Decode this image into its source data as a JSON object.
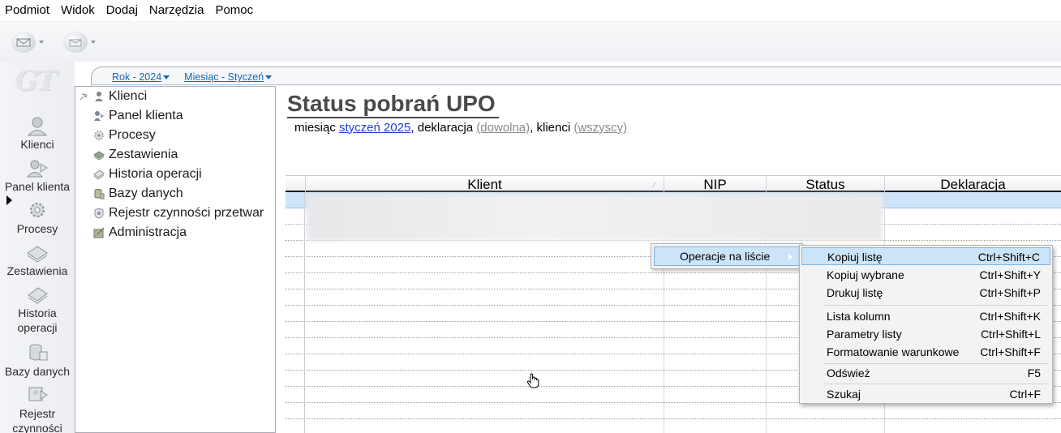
{
  "menubar": {
    "items": [
      "Podmiot",
      "Widok",
      "Dodaj",
      "Narzędzia",
      "Pomoc"
    ]
  },
  "toolbar": {
    "buttons": [
      {
        "icon": "mail-send-icon"
      },
      {
        "icon": "mail-receive-icon"
      }
    ]
  },
  "leftnav": {
    "logo": "GT",
    "items": [
      {
        "label": "Klienci",
        "icon": "person-icon"
      },
      {
        "label": "Panel klienta",
        "icon": "person-panel-icon"
      },
      {
        "label": "Procesy",
        "icon": "gears-icon"
      },
      {
        "label": "Zestawienia",
        "icon": "reports-icon"
      },
      {
        "label": "Historia operacji",
        "icon": "history-icon"
      },
      {
        "label": "Bazy danych",
        "icon": "database-icon"
      },
      {
        "label": "Rejestr czynności",
        "icon": "register-icon"
      }
    ]
  },
  "period": {
    "year": "Rok - 2024",
    "month": "Miesiąc - Styczeń"
  },
  "tree": {
    "items": [
      {
        "label": "Klienci",
        "icon": "person-icon"
      },
      {
        "label": "Panel klienta",
        "icon": "person-panel-icon"
      },
      {
        "label": "Procesy",
        "icon": "gears-icon"
      },
      {
        "label": "Zestawienia",
        "icon": "reports-icon"
      },
      {
        "label": "Historia operacji",
        "icon": "history-icon"
      },
      {
        "label": "Bazy danych",
        "icon": "database-icon"
      },
      {
        "label": "Rejestr czynności przetwar",
        "icon": "register-icon"
      },
      {
        "label": "Administracja",
        "icon": "admin-icon"
      }
    ]
  },
  "page": {
    "title": "Status pobrań UPO",
    "subtitle": {
      "prefix": "miesiąc ",
      "month_link": "styczeń 2025",
      "mid1": ", deklaracja ",
      "decl_link": "(dowolna)",
      "mid2": ", klienci ",
      "clients_link": "(wszyscy)"
    }
  },
  "grid": {
    "columns": [
      "Klient",
      "NIP",
      "Status",
      "Deklaracja"
    ]
  },
  "context_menu": {
    "parent_item": "Operacje na liście",
    "submenu": [
      {
        "label": "Kopiuj listę",
        "shortcut": "Ctrl+Shift+C"
      },
      {
        "label": "Kopiuj wybrane",
        "shortcut": "Ctrl+Shift+Y"
      },
      {
        "label": "Drukuj listę",
        "shortcut": "Ctrl+Shift+P"
      },
      {
        "label": "Lista kolumn",
        "shortcut": "Ctrl+Shift+K"
      },
      {
        "label": "Parametry listy",
        "shortcut": "Ctrl+Shift+L"
      },
      {
        "label": "Formatowanie warunkowe",
        "shortcut": "Ctrl+Shift+F"
      },
      {
        "label": "Odśwież",
        "shortcut": "F5"
      },
      {
        "label": "Szukaj",
        "shortcut": "Ctrl+F"
      }
    ]
  },
  "colors": {
    "link_blue": "#1565c0",
    "selection": "#cce4f7",
    "row_selected": "#cfe3f7"
  }
}
